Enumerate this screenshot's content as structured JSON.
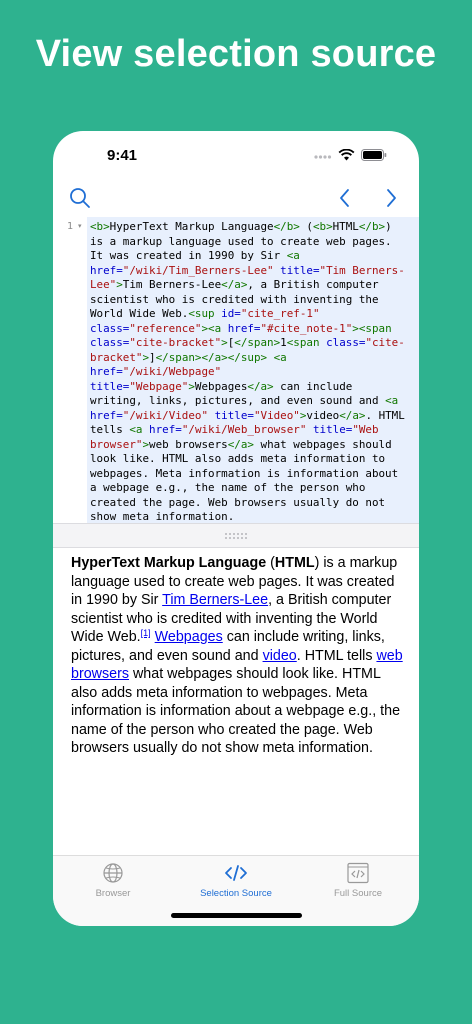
{
  "headline": "View selection source",
  "status": {
    "time": "9:41"
  },
  "colors": {
    "background": "#2eb28f",
    "accent": "#1f6ed4",
    "tag": "#117700",
    "attr": "#0000cc",
    "string": "#aa1111"
  },
  "nav": {
    "search_icon": "search-icon",
    "back_icon": "chevron-left-icon",
    "forward_icon": "chevron-right-icon"
  },
  "editor": {
    "line_number": "1",
    "fold_marker": "▾",
    "code": [
      [
        [
          "tag",
          "<b>"
        ],
        [
          "txt",
          "HyperText Markup Language"
        ],
        [
          "tag",
          "</b>"
        ],
        [
          "txt",
          " ("
        ],
        [
          "tag",
          "<b>"
        ],
        [
          "txt",
          "HTML"
        ],
        [
          "tag",
          "</b>"
        ],
        [
          "txt",
          ")"
        ]
      ],
      [
        [
          "txt",
          "is a markup language used to create web pages."
        ]
      ],
      [
        [
          "txt",
          "It was created in 1990 by Sir "
        ],
        [
          "tag",
          "<a"
        ]
      ],
      [
        [
          "attr",
          "href="
        ],
        [
          "str",
          "\"/wiki/Tim_Berners-Lee\""
        ],
        [
          "txt",
          " "
        ],
        [
          "attr",
          "title="
        ],
        [
          "str",
          "\"Tim Berners-"
        ]
      ],
      [
        [
          "str",
          "Lee\""
        ],
        [
          "tag",
          ">"
        ],
        [
          "txt",
          "Tim Berners-Lee"
        ],
        [
          "tag",
          "</a>"
        ],
        [
          "txt",
          ", a British computer"
        ]
      ],
      [
        [
          "txt",
          "scientist who is credited with inventing the"
        ]
      ],
      [
        [
          "txt",
          "World Wide Web."
        ],
        [
          "tag",
          "<sup"
        ],
        [
          "txt",
          " "
        ],
        [
          "attr",
          "id="
        ],
        [
          "str",
          "\"cite_ref-1\""
        ]
      ],
      [
        [
          "attr",
          "class="
        ],
        [
          "str",
          "\"reference\""
        ],
        [
          "tag",
          "><a"
        ],
        [
          "txt",
          " "
        ],
        [
          "attr",
          "href="
        ],
        [
          "str",
          "\"#cite_note-1\""
        ],
        [
          "tag",
          "><span"
        ]
      ],
      [
        [
          "attr",
          "class="
        ],
        [
          "str",
          "\"cite-bracket\""
        ],
        [
          "tag",
          ">"
        ],
        [
          "txt",
          "["
        ],
        [
          "tag",
          "</span>"
        ],
        [
          "txt",
          "1"
        ],
        [
          "tag",
          "<span"
        ],
        [
          "txt",
          " "
        ],
        [
          "attr",
          "class="
        ],
        [
          "str",
          "\"cite-"
        ]
      ],
      [
        [
          "str",
          "bracket\""
        ],
        [
          "tag",
          ">"
        ],
        [
          "txt",
          "]"
        ],
        [
          "tag",
          "</span></a></sup>"
        ],
        [
          "txt",
          " "
        ],
        [
          "tag",
          "<a"
        ]
      ],
      [
        [
          "attr",
          "href="
        ],
        [
          "str",
          "\"/wiki/Webpage\""
        ]
      ],
      [
        [
          "attr",
          "title="
        ],
        [
          "str",
          "\"Webpage\""
        ],
        [
          "tag",
          ">"
        ],
        [
          "txt",
          "Webpages"
        ],
        [
          "tag",
          "</a>"
        ],
        [
          "txt",
          " can include"
        ]
      ],
      [
        [
          "txt",
          "writing, links, pictures, and even sound and "
        ],
        [
          "tag",
          "<a"
        ]
      ],
      [
        [
          "attr",
          "href="
        ],
        [
          "str",
          "\"/wiki/Video\""
        ],
        [
          "txt",
          " "
        ],
        [
          "attr",
          "title="
        ],
        [
          "str",
          "\"Video\""
        ],
        [
          "tag",
          ">"
        ],
        [
          "txt",
          "video"
        ],
        [
          "tag",
          "</a>"
        ],
        [
          "txt",
          ". HTML"
        ]
      ],
      [
        [
          "txt",
          "tells "
        ],
        [
          "tag",
          "<a"
        ],
        [
          "txt",
          " "
        ],
        [
          "attr",
          "href="
        ],
        [
          "str",
          "\"/wiki/Web_browser\""
        ],
        [
          "txt",
          " "
        ],
        [
          "attr",
          "title="
        ],
        [
          "str",
          "\"Web"
        ]
      ],
      [
        [
          "str",
          "browser\""
        ],
        [
          "tag",
          ">"
        ],
        [
          "txt",
          "web browsers"
        ],
        [
          "tag",
          "</a>"
        ],
        [
          "txt",
          " what webpages should"
        ]
      ],
      [
        [
          "txt",
          "look like. HTML also adds meta information to"
        ]
      ],
      [
        [
          "txt",
          "webpages. Meta information is information about"
        ]
      ],
      [
        [
          "txt",
          "a webpage e.g., the name of the person who"
        ]
      ],
      [
        [
          "txt",
          "created the page. Web browsers usually do not"
        ]
      ],
      [
        [
          "txt",
          "show meta information."
        ]
      ]
    ]
  },
  "preview": {
    "t1": "HyperText Markup Language",
    "t2": " (",
    "t3": "HTML",
    "t4": ") is a markup language used to create web pages. It was created in 1990 by Sir ",
    "link1": "Tim Berners-Lee",
    "t5": ", a British computer scientist who is credited with inventing the World Wide Web.",
    "sup": "[1]",
    "t6": " ",
    "link2": "Webpages",
    "t7": " can include writing, links, pictures, and even sound and ",
    "link3": "video",
    "t8": ". HTML tells ",
    "link4": "web browsers",
    "t9": " what webpages should look like. HTML also adds meta information to webpages. Meta information is information about a webpage e.g., the name of the person who created the page. Web browsers usually do not show meta information."
  },
  "tabs": [
    {
      "label": "Browser",
      "icon": "globe-icon",
      "active": false
    },
    {
      "label": "Selection Source",
      "icon": "code-icon",
      "active": true
    },
    {
      "label": "Full Source",
      "icon": "code-document-icon",
      "active": false
    }
  ]
}
